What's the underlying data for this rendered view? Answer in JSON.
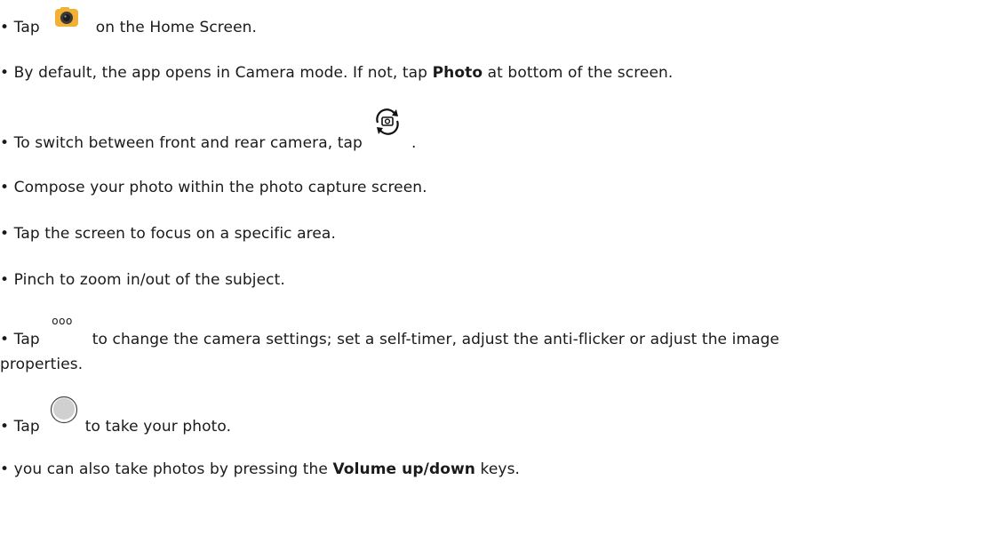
{
  "bullet": "•",
  "step1": {
    "before": "Tap",
    "icon": "camera-app-icon",
    "after": "on the Home Screen."
  },
  "step2": {
    "before": "By default, the app opens in Camera mode. If not, tap",
    "bold": "Photo",
    "after": "at bottom of the screen."
  },
  "step3": {
    "before": "To switch between front and rear camera, tap",
    "icon": "switch-camera-icon",
    "after": "."
  },
  "step4": {
    "text": "Compose your photo within the photo capture screen."
  },
  "step5": {
    "text": "Tap the screen to focus on a specific area."
  },
  "step6": {
    "text": "Pinch to zoom in/out of the subject."
  },
  "step7": {
    "before": "Tap",
    "icon_glyph": "ooo",
    "icon": "more-options-icon",
    "after": "to change the camera settings; set a self-timer, adjust the anti-flicker or adjust the image",
    "continuation": "properties."
  },
  "step8": {
    "before": "Tap",
    "icon": "shutter-button-icon",
    "after": "to take your photo."
  },
  "step9": {
    "before": "you can also take photos by pressing the",
    "bold": "Volume up/down",
    "after": "keys."
  },
  "colors": {
    "text": "#1a1a1a",
    "camera_icon_body": "#f2b134",
    "shutter_fill": "#d0d0d0"
  }
}
